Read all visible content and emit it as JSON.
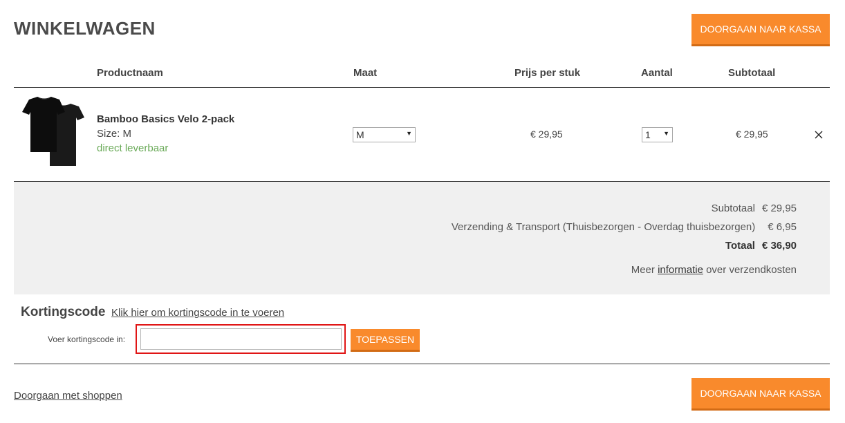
{
  "page": {
    "title": "WINKELWAGEN"
  },
  "header": {
    "checkout_label": "DOORGAAN NAAR KASSA"
  },
  "table": {
    "columns": {
      "product": "Productnaam",
      "size": "Maat",
      "price": "Prijs per stuk",
      "quantity": "Aantal",
      "subtotal": "Subtotaal"
    }
  },
  "cart_item": {
    "name": "Bamboo Basics Velo 2-pack",
    "size_text": "Size:  M",
    "stock": "direct leverbaar",
    "selected_size": "M",
    "price": "€ 29,95",
    "selected_quantity": "1",
    "subtotal": "€ 29,95"
  },
  "totals": {
    "subtotal_label": "Subtotaal",
    "subtotal_value": "€ 29,95",
    "shipping_label": "Verzending & Transport (Thuisbezorgen - Overdag thuisbezorgen)",
    "shipping_value": "€ 6,95",
    "total_label": "Totaal",
    "total_value": "€ 36,90",
    "info_prefix": "Meer",
    "info_link": "informatie",
    "info_suffix": "over verzendkosten"
  },
  "coupon": {
    "title": "Kortingscode",
    "toggle_link": "Klik hier om kortingscode in te voeren",
    "field_label": "Voer kortingscode in:",
    "value": "",
    "apply_label": "TOEPASSEN"
  },
  "footer": {
    "continue_shopping": "Doorgaan met shoppen",
    "checkout_label": "DOORGAAN NAAR KASSA"
  },
  "colors": {
    "accent": "#f98a2c",
    "stock_green": "#6aaa58",
    "highlight_red": "#e01515",
    "panel_gray": "#f0f0f0"
  }
}
